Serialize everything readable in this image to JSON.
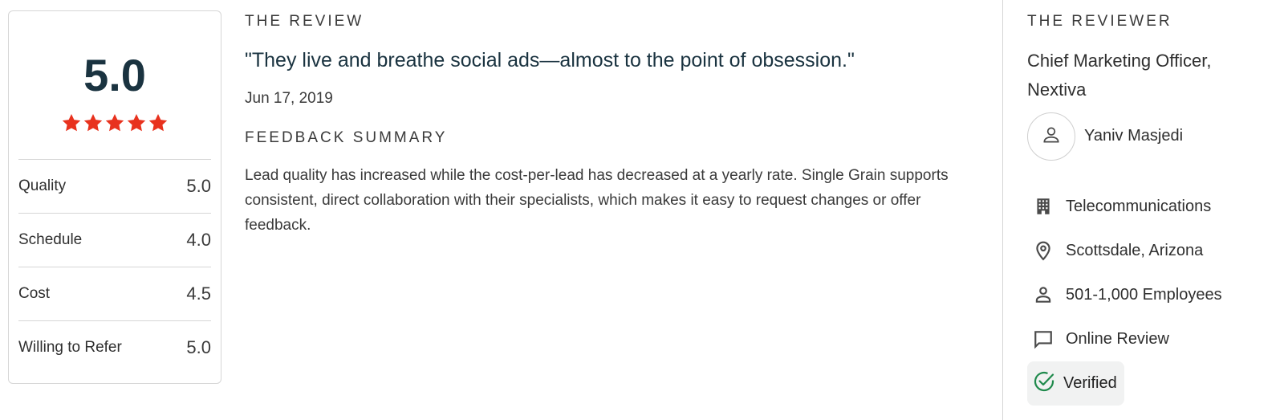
{
  "rating_card": {
    "overall_score": "5.0",
    "stars_filled": 5,
    "stars_total": 5,
    "star_color": "#e8321e",
    "categories": [
      {
        "label": "Quality",
        "score": "5.0"
      },
      {
        "label": "Schedule",
        "score": "4.0"
      },
      {
        "label": "Cost",
        "score": "4.5"
      },
      {
        "label": "Willing to Refer",
        "score": "5.0"
      }
    ]
  },
  "review": {
    "heading": "THE REVIEW",
    "quote": "\"They live and breathe social ads—almost to the point of obsession.\"",
    "date": "Jun 17, 2019",
    "feedback_heading": "FEEDBACK SUMMARY",
    "feedback_summary": "Lead quality has increased while the cost-per-lead has decreased at a yearly rate. Single Grain supports consistent, direct collaboration with their specialists, which makes it easy to request changes or offer feedback."
  },
  "reviewer": {
    "heading": "THE REVIEWER",
    "title": "Chief Marketing Officer, Nextiva",
    "avatar_icon": "user-icon",
    "name": "Yaniv Masjedi",
    "details": [
      {
        "icon": "building-icon",
        "text": "Telecommunications"
      },
      {
        "icon": "location-pin-icon",
        "text": "Scottsdale, Arizona"
      },
      {
        "icon": "person-icon",
        "text": "501-1,000 Employees"
      },
      {
        "icon": "chat-bubble-icon",
        "text": "Online Review"
      }
    ],
    "verified": {
      "icon": "check-circle-icon",
      "label": "Verified",
      "color": "#1f8a4c"
    }
  },
  "colors": {
    "heading_text": "#1a3340",
    "divider": "#d6d6d6"
  }
}
